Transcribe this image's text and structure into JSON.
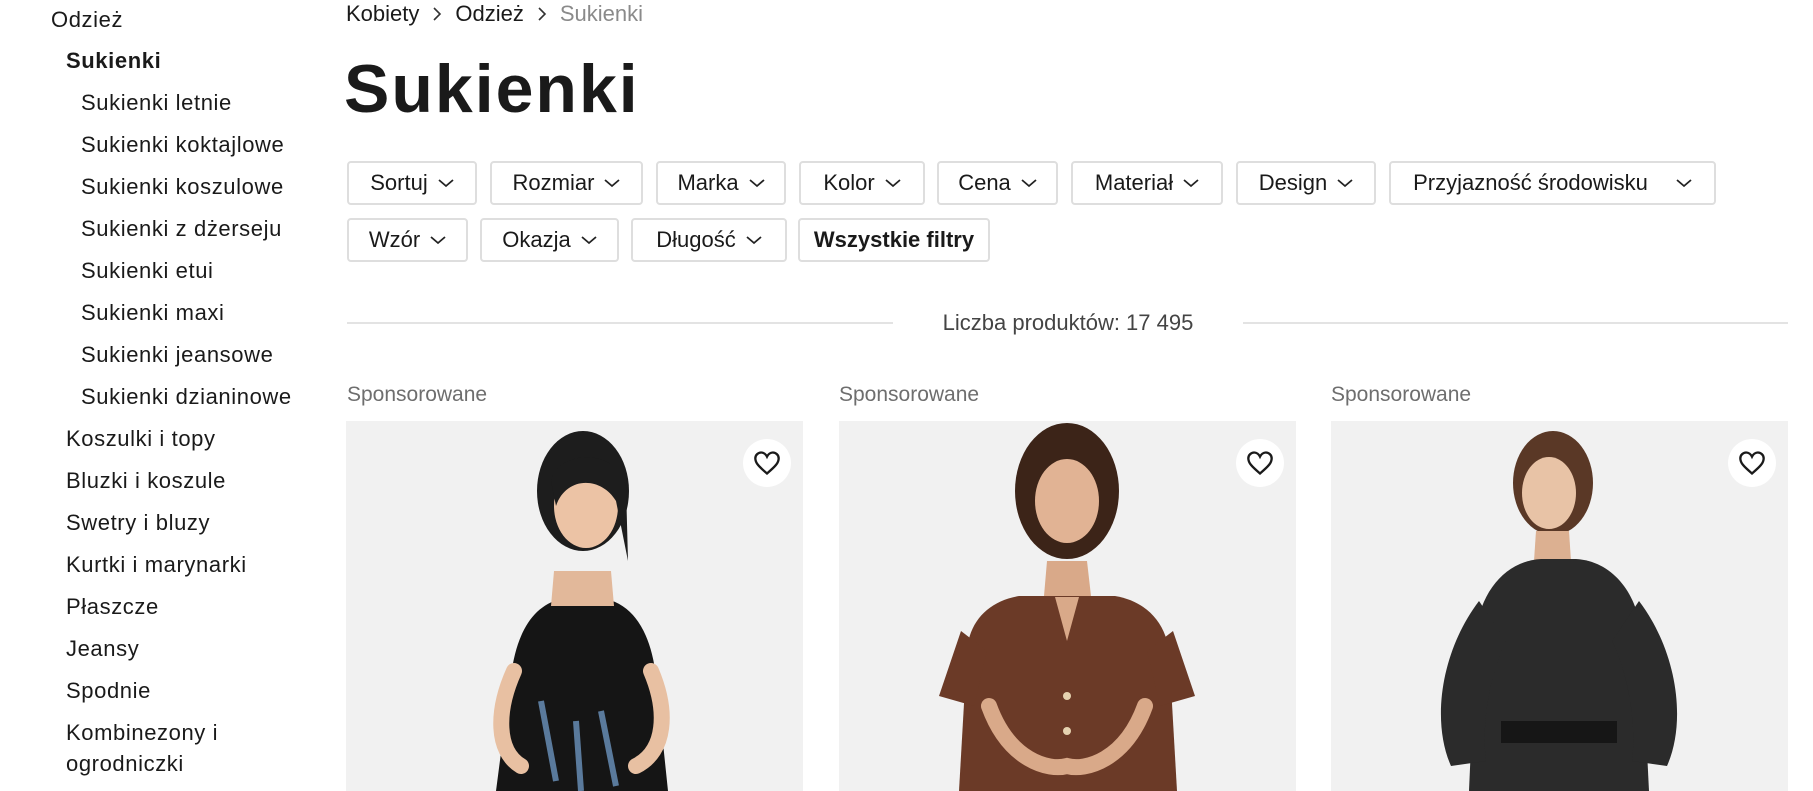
{
  "sidebar": {
    "items": [
      {
        "label": "Odzież"
      },
      {
        "label": "Sukienki"
      },
      {
        "label": "Sukienki letnie"
      },
      {
        "label": "Sukienki koktajlowe"
      },
      {
        "label": "Sukienki koszulowe"
      },
      {
        "label": "Sukienki z dżerseju"
      },
      {
        "label": "Sukienki etui"
      },
      {
        "label": "Sukienki maxi"
      },
      {
        "label": "Sukienki jeansowe"
      },
      {
        "label": "Sukienki dzianinowe"
      },
      {
        "label": "Koszulki i topy"
      },
      {
        "label": "Bluzki i koszule"
      },
      {
        "label": "Swetry i bluzy"
      },
      {
        "label": "Kurtki i marynarki"
      },
      {
        "label": "Płaszcze"
      },
      {
        "label": "Jeansy"
      },
      {
        "label": "Spodnie"
      },
      {
        "label": "Kombinezony i ogrodniczki"
      }
    ]
  },
  "breadcrumb": [
    {
      "label": "Kobiety"
    },
    {
      "label": "Odzież"
    },
    {
      "label": "Sukienki"
    }
  ],
  "page": {
    "title": "Sukienki"
  },
  "filters": [
    {
      "label": "Sortuj"
    },
    {
      "label": "Rozmiar"
    },
    {
      "label": "Marka"
    },
    {
      "label": "Kolor"
    },
    {
      "label": "Cena"
    },
    {
      "label": "Materiał"
    },
    {
      "label": "Design"
    },
    {
      "label": "Przyjazność środowisku"
    },
    {
      "label": "Wzór"
    },
    {
      "label": "Okazja"
    },
    {
      "label": "Długość"
    },
    {
      "label": "Wszystkie filtry"
    }
  ],
  "results": {
    "count_text": "Liczba produktów: 17 495"
  },
  "products": [
    {
      "sponsored_label": "Sponsorowane",
      "dress_color": "#151515"
    },
    {
      "sponsored_label": "Sponsorowane",
      "dress_color": "#6b3a27"
    },
    {
      "sponsored_label": "Sponsorowane",
      "dress_color": "#2b2b2b"
    }
  ],
  "colors": {
    "border": "#dedede",
    "image_bg": "#f1f1f1",
    "muted_text": "#8a8a8a"
  }
}
